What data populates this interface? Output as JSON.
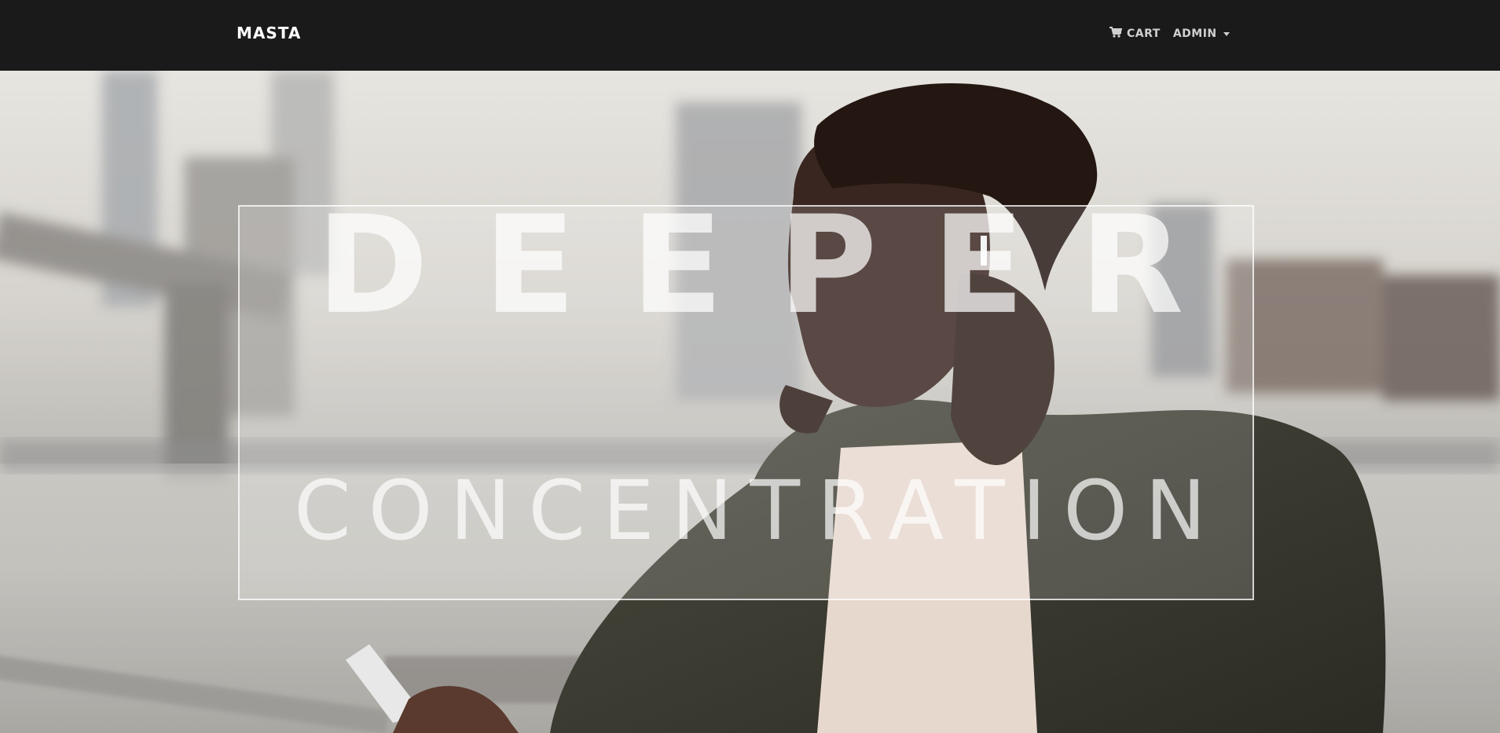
{
  "nav": {
    "brand": "MASTA",
    "cart_label": "CART",
    "cart_icon": "cart-icon",
    "admin_label": "ADMIN",
    "admin_icon": "caret-down-icon"
  },
  "hero": {
    "headline": "DEEPER",
    "subheadline": "CONCENTRATION"
  },
  "colors": {
    "navbar_bg": "#1a1a1a",
    "brand_text": "#ffffff",
    "nav_text": "#d0d0d0"
  }
}
